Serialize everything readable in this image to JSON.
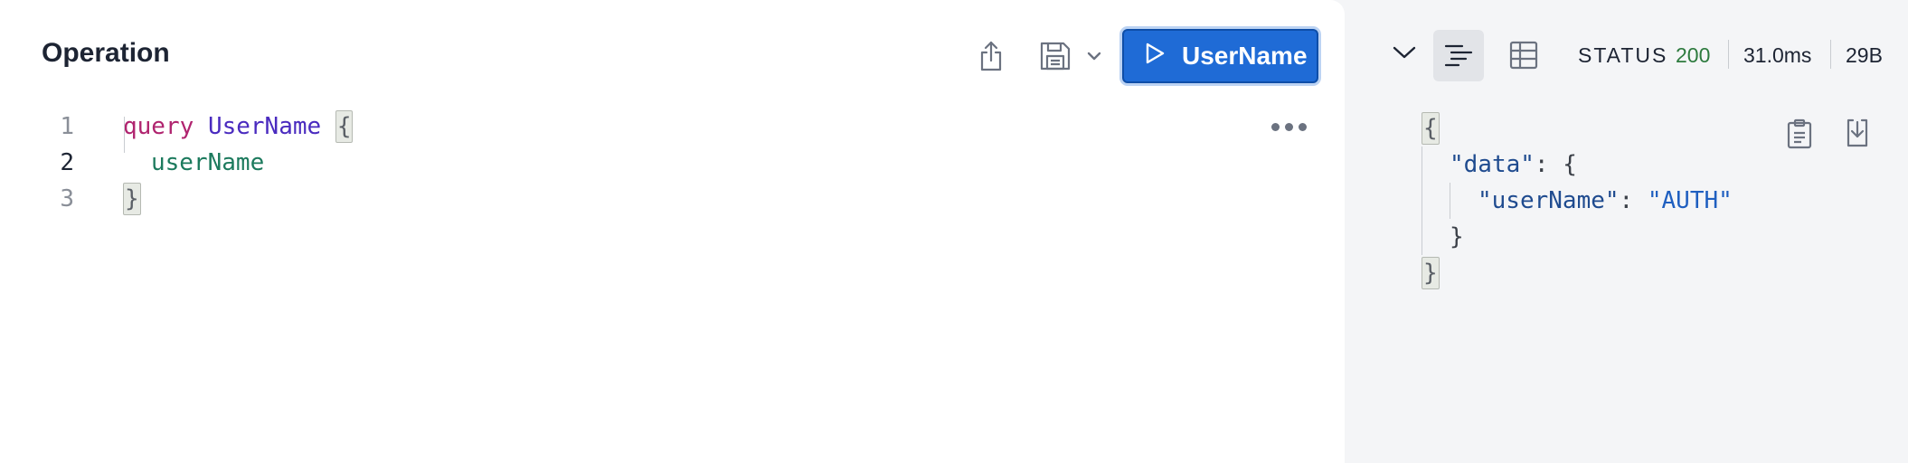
{
  "operation": {
    "title": "Operation",
    "run_label": "UserName",
    "code": {
      "line_numbers": [
        "1",
        "2",
        "3"
      ],
      "keyword": "query",
      "name": "UserName",
      "open_brace": "{",
      "field": "userName",
      "close_brace": "}"
    }
  },
  "response": {
    "status_label": "STATUS",
    "status_code": "200",
    "time": "31.0ms",
    "size": "29B",
    "json": {
      "open_brace": "{",
      "data_key": "\"data\"",
      "colon": ":",
      "data_open": "{",
      "username_key": "\"userName\"",
      "username_value": "\"AUTH\"",
      "data_close": "}",
      "close_brace": "}"
    }
  },
  "colors": {
    "accent": "#1f6bd6",
    "status_ok": "#2d7a3e"
  },
  "icons": [
    "share-icon",
    "save-icon",
    "chevron-down-icon",
    "play-icon",
    "more-icon",
    "collapse-chevron-icon",
    "text-view-icon",
    "table-view-icon",
    "copy-icon",
    "download-icon"
  ]
}
